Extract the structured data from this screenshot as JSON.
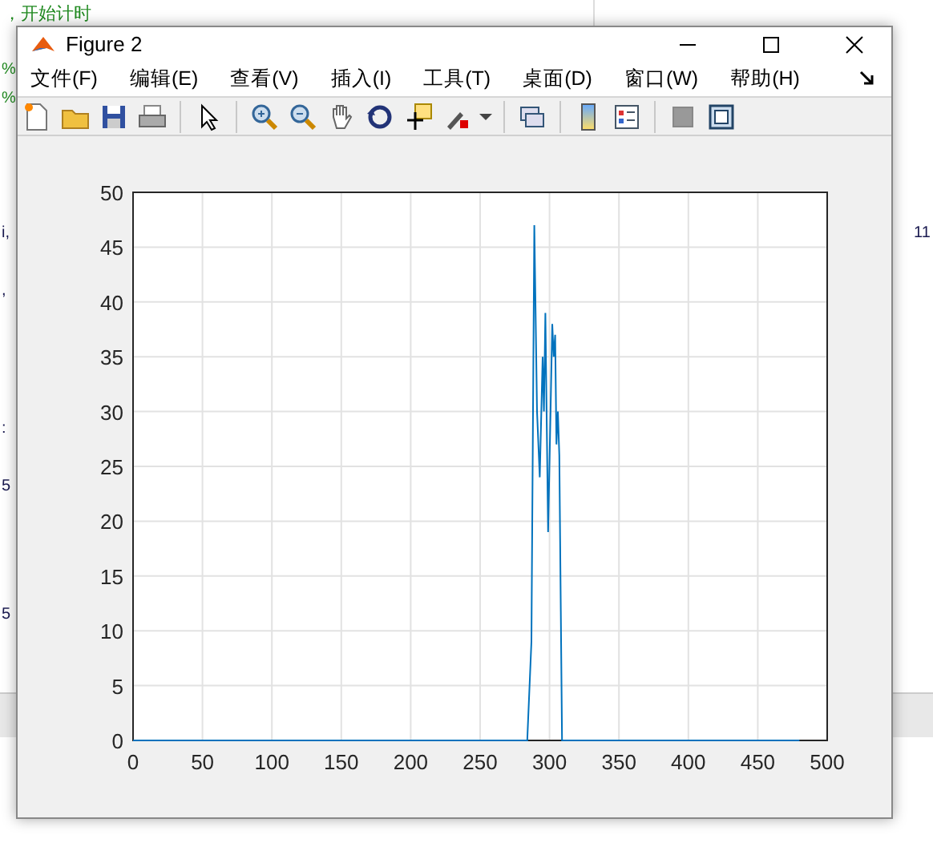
{
  "editor": {
    "left_lines": [
      {
        "text": "，开始计时",
        "kind": "comment"
      },
      {
        "text": "%",
        "kind": "comment"
      },
      {
        "text": "%",
        "kind": "comment"
      },
      {
        "text": "i,",
        "kind": "code"
      },
      {
        "text": ",",
        "kind": "code"
      },
      {
        "text": ":",
        "kind": "code"
      },
      {
        "text": "5",
        "kind": "code"
      },
      {
        "text": "5",
        "kind": "code"
      }
    ],
    "right_lines": [
      {
        "text": "11",
        "kind": "code"
      }
    ]
  },
  "window": {
    "title": "Figure 2"
  },
  "menu": [
    {
      "label": "文件(F)"
    },
    {
      "label": "编辑(E)"
    },
    {
      "label": "查看(V)"
    },
    {
      "label": "插入(I)"
    },
    {
      "label": "工具(T)"
    },
    {
      "label": "桌面(D)"
    },
    {
      "label": "窗口(W)"
    },
    {
      "label": "帮助(H)"
    }
  ],
  "chart_data": {
    "type": "line",
    "grid": true,
    "xlim": [
      0,
      500
    ],
    "ylim": [
      0,
      50
    ],
    "xticks": [
      0,
      50,
      100,
      150,
      200,
      250,
      300,
      350,
      400,
      450,
      500
    ],
    "yticks": [
      0,
      5,
      10,
      15,
      20,
      25,
      30,
      35,
      40,
      45,
      50
    ],
    "x": [
      0,
      284,
      287,
      289,
      291,
      293,
      295,
      296,
      297,
      299,
      301,
      302,
      303,
      304,
      305,
      306,
      307,
      309,
      480
    ],
    "series": [
      {
        "color": "#0072bd",
        "values": [
          0,
          0,
          9,
          47,
          30,
          24,
          35,
          30,
          39,
          19,
          32,
          38,
          35,
          37,
          27,
          30,
          26,
          0,
          0
        ]
      }
    ]
  }
}
